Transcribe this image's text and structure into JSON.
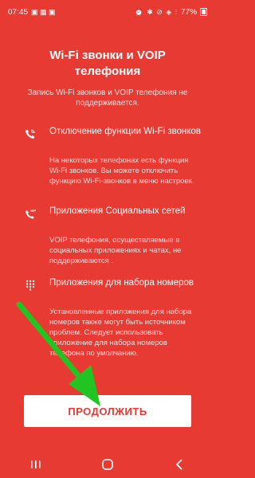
{
  "status": {
    "time": "07:45",
    "battery": "77%"
  },
  "title": "Wi-Fi звонки и VOIP телефония",
  "intro": "Запись Wi-Fi звонков и VOIP телефония не поддерживается.",
  "sections": [
    {
      "icon": "wifi-call-icon",
      "title": "Отключение функции Wi-Fi звонков",
      "body": "На некоторых телефонах есть функция Wi-Fi звонков. Вы можете отключить функцию Wi-Fi-звонков в меню настроек."
    },
    {
      "icon": "sip-phone-icon",
      "title": "Приложения Социальных сетей",
      "body": "VOIP телефония, осуществляемые в социальных приложениях и чатах, не поддерживаются ."
    },
    {
      "icon": "dialpad-icon",
      "title": "Приложения для набора номеров",
      "body": "Установленные приложения для набора номеров также могут быть источником проблем. Следует использовать приложение для набора номеров телефона по умолчанию."
    }
  ],
  "button": {
    "continue_label": "ПРОДОЛЖИТЬ"
  },
  "colors": {
    "background": "#e63a32",
    "arrow": "#22c421"
  }
}
